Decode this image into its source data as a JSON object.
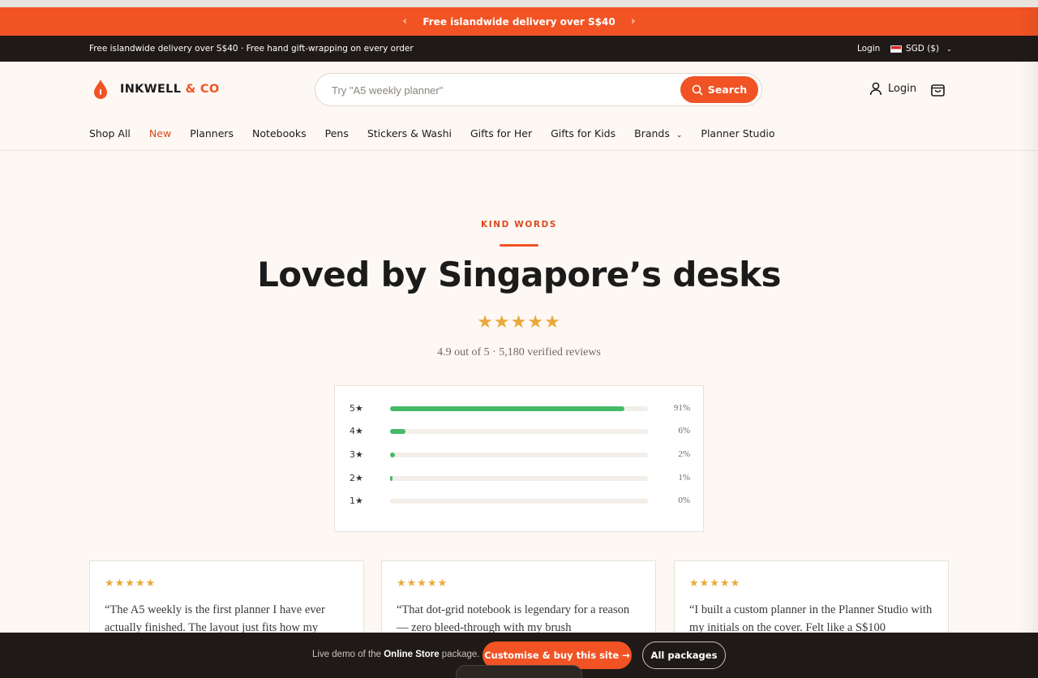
{
  "promo": {
    "text": "Free islandwide delivery over S$40",
    "prev_icon": "‹",
    "next_icon": "›"
  },
  "infobar": {
    "text": "Free islandwide delivery over S$40 · Free hand gift-wrapping on every order",
    "login": "Login",
    "currency": "SGD ($)"
  },
  "header": {
    "brand_main": "INKWELL ",
    "brand_accent": "& CO",
    "search_placeholder": "Try \"A5 weekly planner\"",
    "search_button": "Search",
    "account_label": "Login"
  },
  "nav": {
    "items": [
      "Shop All",
      "New",
      "Planners",
      "Notebooks",
      "Pens",
      "Stickers & Washi",
      "Gifts for Her",
      "Gifts for Kids",
      "Brands",
      "Planner Studio"
    ]
  },
  "reviews": {
    "eyebrow": "KIND WORDS",
    "title": "Loved by Singapore’s desks",
    "stars": "★★★★★",
    "summary": "4.9 out of 5 · 5,180 verified reviews",
    "distribution": [
      {
        "label": "5★",
        "percent": 91,
        "percent_text": "91%"
      },
      {
        "label": "4★",
        "percent": 6,
        "percent_text": "6%"
      },
      {
        "label": "3★",
        "percent": 2,
        "percent_text": "2%"
      },
      {
        "label": "2★",
        "percent": 1,
        "percent_text": "1%"
      },
      {
        "label": "1★",
        "percent": 0,
        "percent_text": "0%"
      }
    ],
    "cards": [
      {
        "stars": "★★★★★",
        "quote": "“The A5 weekly is the first planner I have ever actually finished. The layout just fits how my"
      },
      {
        "stars": "★★★★★",
        "quote": "“That dot-grid notebook is legendary for a reason — zero bleed-through with my brush"
      },
      {
        "stars": "★★★★★",
        "quote": "“I built a custom planner in the Planner Studio with my initials on the cover. Felt like a S$100"
      }
    ]
  },
  "demo_bar": {
    "text_prefix": "Live demo of the ",
    "text_bold": "Online Store",
    "text_suffix": " package.",
    "buy_button": "Customise & buy this site →",
    "all_button": "All packages"
  },
  "colors": {
    "accent": "#f15324",
    "dark": "#1f1a17",
    "star": "#e9a93a",
    "bar": "#47b96b",
    "background": "#fdf8f3"
  }
}
